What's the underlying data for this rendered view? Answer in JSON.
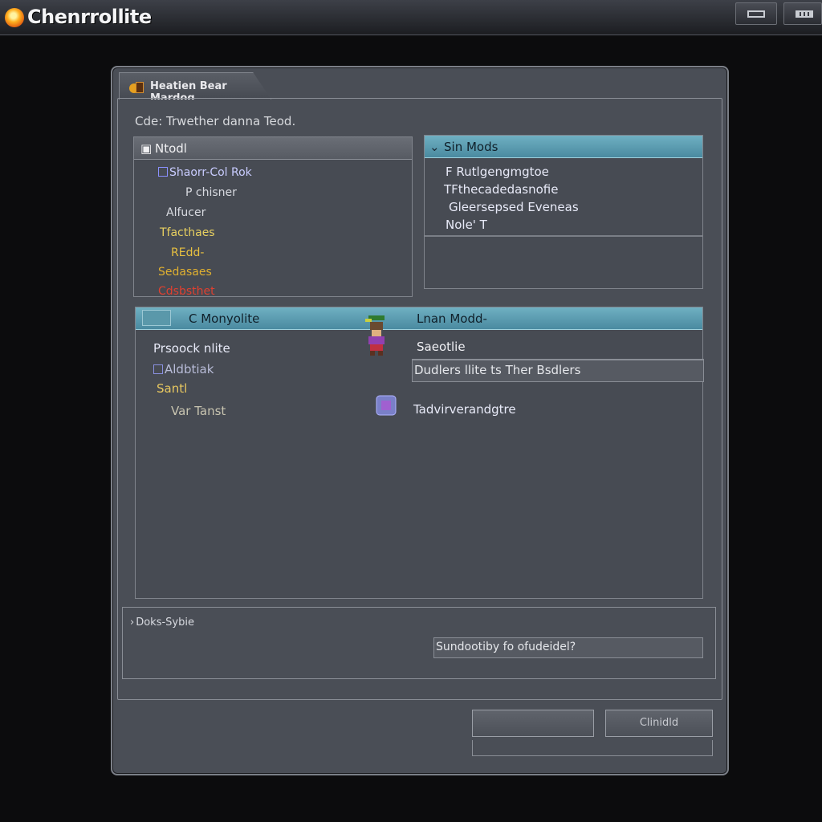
{
  "app": {
    "title": "Chenrrollite"
  },
  "dialog": {
    "tab_label": "Heatien Bear Mardog",
    "subtitle": "Cde: Trwether danna Teod.",
    "left_panel": {
      "header": "Ntodl",
      "items": [
        {
          "label": "Shaorr-Col Rok",
          "color": "#c9ccff"
        },
        {
          "label": "P chisner",
          "color": "#d8dae0"
        },
        {
          "label": "Alfucer",
          "color": "#d8dae0"
        },
        {
          "label": "Tfacthaes",
          "color": "#e8d060"
        },
        {
          "label": "REdd-",
          "color": "#e8c040"
        },
        {
          "label": "Sedasaes",
          "color": "#e0b030"
        },
        {
          "label": "Cdsbsthet",
          "color": "#e04030"
        }
      ]
    },
    "right_panel": {
      "header": "Sin Mods",
      "items": [
        "F Rutlgengmgtoe",
        "TFthecadedasnofie",
        "Gleersepsed Eveneas",
        "Nole' T"
      ]
    },
    "main_panel": {
      "header_left": "C Monyolite",
      "header_right": "Lnan Modd-",
      "left_items": [
        {
          "label": "Prsoock nlite",
          "color": "#e8eaf8"
        },
        {
          "label": "Aldbtiak",
          "color": "#b8bcd8"
        },
        {
          "label": "Santl",
          "color": "#e8c860"
        },
        {
          "label": "Var  Tanst",
          "color": "#c8c4b0"
        }
      ],
      "right_title": "Saeotlie",
      "right_field": "Dudlers llite ts Ther Bsdlers",
      "right_item": "Tadvirverandgtre"
    },
    "footer": {
      "label": "Doks-Sybie",
      "field": "Sundootiby fo ofudeidel?",
      "button_left": "",
      "button_right": "Clinidld"
    }
  }
}
